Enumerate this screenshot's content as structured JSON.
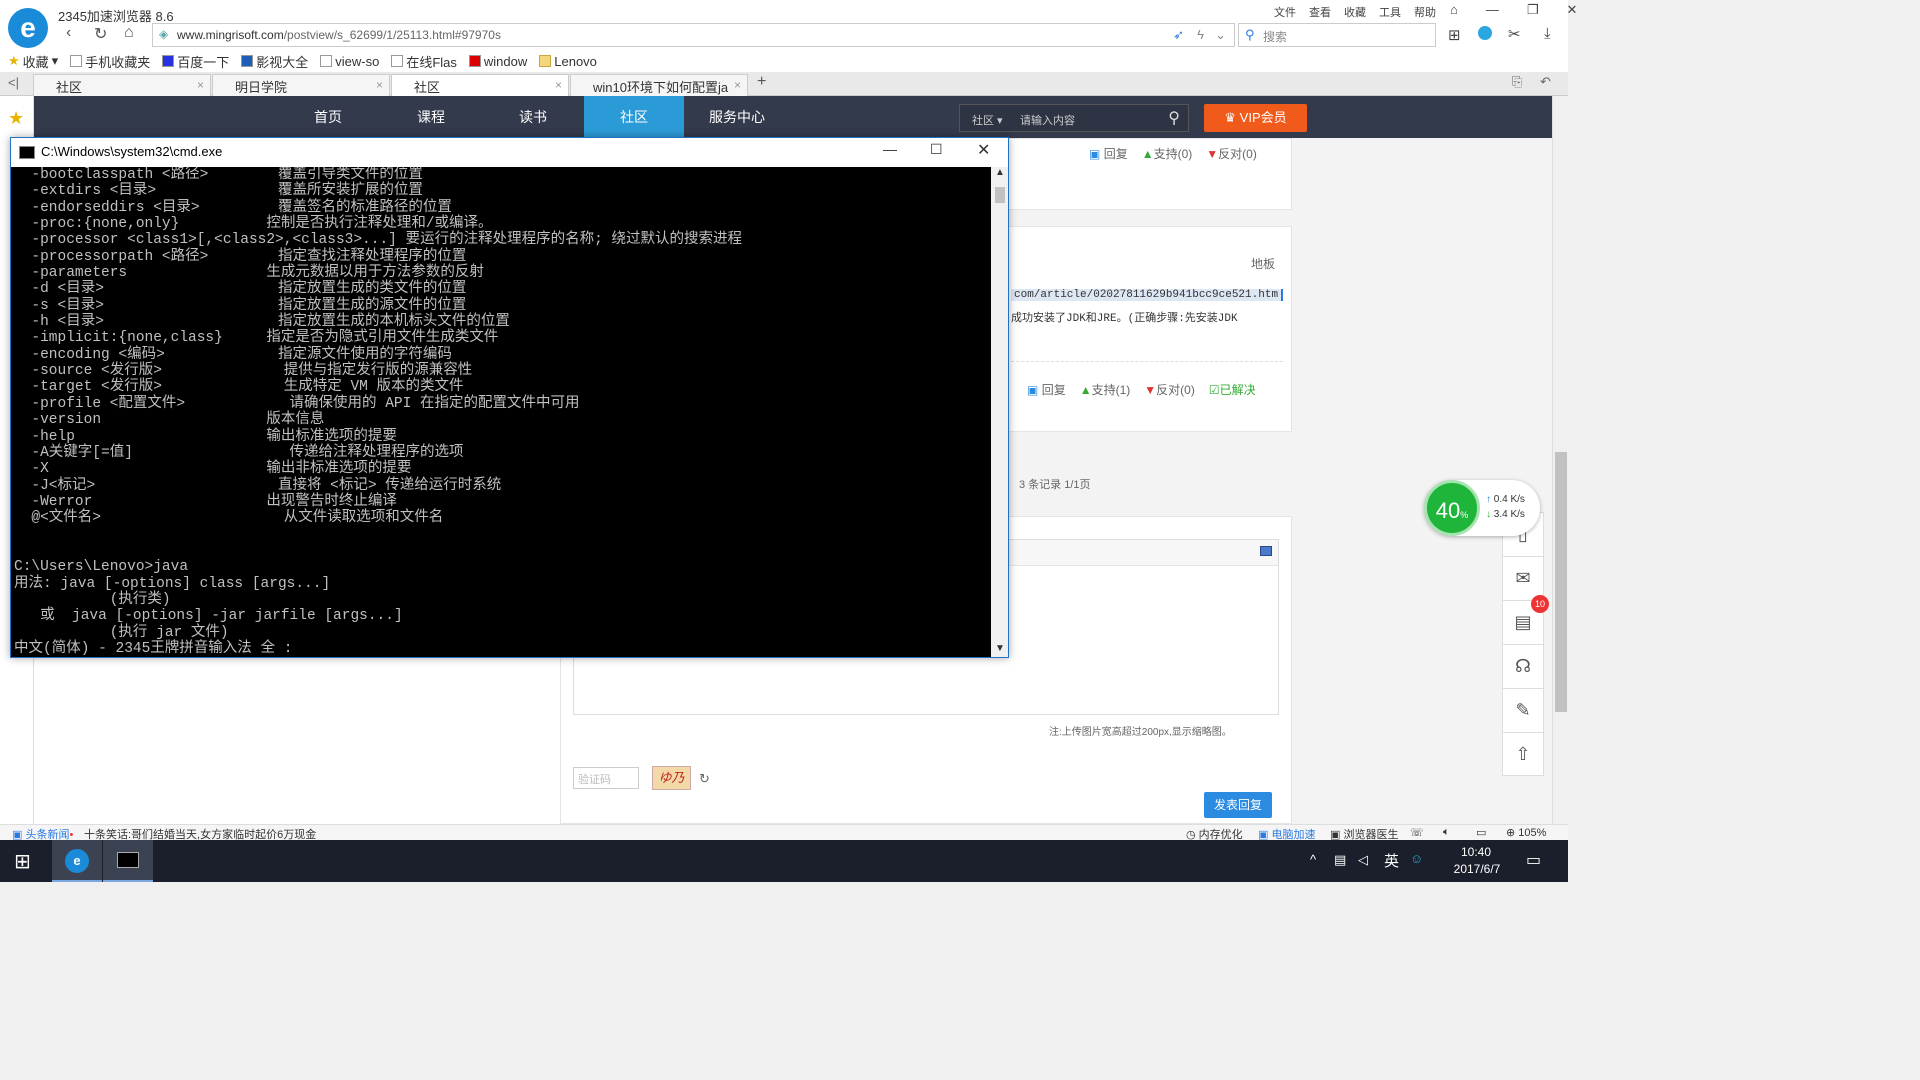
{
  "browser": {
    "app_title": "2345加速浏览器 8.6",
    "menu": [
      "文件",
      "查看",
      "收藏",
      "工具",
      "帮助"
    ],
    "url_domain": "www.mingrisoft.com",
    "url_path": "/postview/s_62699/1/25113.html#97970s",
    "search_placeholder": "搜索",
    "favorites": [
      "收藏",
      "手机收藏夹",
      "百度一下",
      "影视大全",
      "view-so",
      "在线Flas",
      "window",
      "Lenovo"
    ],
    "tabs": [
      {
        "label": "社区"
      },
      {
        "label": "明日学院"
      },
      {
        "label": "社区"
      },
      {
        "label": "win10环境下如何配置ja"
      }
    ]
  },
  "site": {
    "nav": [
      "首页",
      "课程",
      "读书",
      "社区",
      "服务中心"
    ],
    "search_scope": "社区",
    "search_placeholder": "请输入内容",
    "vip_label": "VIP会员",
    "post1_actions": {
      "reply": "回复",
      "support": "支持(0)",
      "oppose": "反对(0)"
    },
    "floor_label": "地板",
    "link_text": "com/article/02027811629b941bcc9ce521.htm",
    "body_text": "成功安装了JDK和JRE。(正确步骤:先安装JDK",
    "post2_actions": {
      "reply": "回复",
      "support": "支持(1)",
      "oppose": "反对(0)",
      "solved": "已解决"
    },
    "records": "3 条记录 1/1页",
    "note": "注:上传图片宽高超过200px,显示缩略图。",
    "captcha_placeholder": "验证码",
    "captcha_text": "ゆ乃",
    "submit_label": "发表回复",
    "badge_count": "10",
    "speed_percent": "40",
    "speed_up": "0.4 K/s",
    "speed_down": "3.4 K/s"
  },
  "cmd": {
    "title": "C:\\Windows\\system32\\cmd.exe",
    "lines": [
      "  -bootclasspath <路径>        覆盖引导类文件的位置",
      "  -extdirs <目录>              覆盖所安装扩展的位置",
      "  -endorseddirs <目录>         覆盖签名的标准路径的位置",
      "  -proc:{none,only}          控制是否执行注释处理和/或编译。",
      "  -processor <class1>[,<class2>,<class3>...] 要运行的注释处理程序的名称; 绕过默认的搜索进程",
      "  -processorpath <路径>        指定查找注释处理程序的位置",
      "  -parameters                生成元数据以用于方法参数的反射",
      "  -d <目录>                    指定放置生成的类文件的位置",
      "  -s <目录>                    指定放置生成的源文件的位置",
      "  -h <目录>                    指定放置生成的本机标头文件的位置",
      "  -implicit:{none,class}     指定是否为隐式引用文件生成类文件",
      "  -encoding <编码>             指定源文件使用的字符编码",
      "  -source <发行版>              提供与指定发行版的源兼容性",
      "  -target <发行版>              生成特定 VM 版本的类文件",
      "  -profile <配置文件>            请确保使用的 API 在指定的配置文件中可用",
      "  -version                   版本信息",
      "  -help                      输出标准选项的提要",
      "  -A关键字[=值]                  传递给注释处理程序的选项",
      "  -X                         输出非标准选项的提要",
      "  -J<标记>                     直接将 <标记> 传递给运行时系统",
      "  -Werror                    出现警告时终止编译",
      "  @<文件名>                     从文件读取选项和文件名",
      "",
      "",
      "C:\\Users\\Lenovo>java",
      "用法: java [-options] class [args...]",
      "           (执行类)",
      "   或  java [-options] -jar jarfile [args...]",
      "           (执行 jar 文件)",
      "中文(简体) - 2345王牌拼音输入法 全 :"
    ]
  },
  "status": {
    "news_label": "头条新闻",
    "news_text": "十条笑话:哥们结婚当天,女方家临时起价6万现金",
    "memory": "内存优化",
    "accelerate": "电脑加速",
    "doctor": "浏览器医生",
    "zoom": "105%"
  },
  "taskbar": {
    "time": "10:40",
    "date": "2017/6/7",
    "ime": "英"
  }
}
